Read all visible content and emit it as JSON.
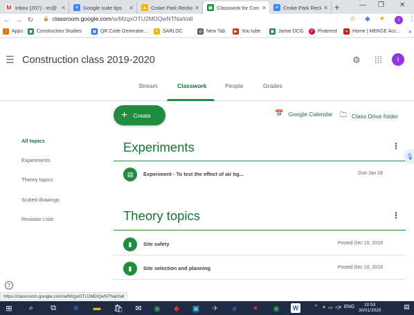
{
  "browser": {
    "tabs": [
      {
        "title": "Inbox (207) - irc@",
        "favicon": "gmail-icon",
        "color": "#d93025"
      },
      {
        "title": "Google suite tips",
        "favicon": "docs-icon",
        "color": "#4285f4"
      },
      {
        "title": "Croke Park Reckon",
        "favicon": "drive-icon",
        "color": "#f4b400"
      },
      {
        "title": "Classwork for Con",
        "favicon": "classroom-icon",
        "color": "#1e8e3e"
      },
      {
        "title": "Croke Park Reckon",
        "favicon": "docs-icon",
        "color": "#4285f4"
      }
    ],
    "new_tab": "+",
    "url_host": "classroom.google.com",
    "url_path": "/w/MzgxOTU2MDQwNTNa/t/all",
    "bookmarks": [
      {
        "label": "Apps",
        "icon": "apps-grid-icon",
        "color": "#e8710a"
      },
      {
        "label": "Construction Studies",
        "icon": "classroom-icon",
        "color": "#1e8e3e"
      },
      {
        "label": "QR Code Generator...",
        "icon": "qr-icon",
        "color": "#1a73e8"
      },
      {
        "label": "SARLOC",
        "icon": "sarloc-icon",
        "color": "#f4b400"
      },
      {
        "label": "New Tab",
        "icon": "globe-icon",
        "color": "#5f6368"
      },
      {
        "label": "You tube",
        "icon": "youtube-icon",
        "color": "#d93025"
      },
      {
        "label": "Jamie DCG",
        "icon": "classroom-icon",
        "color": "#1e8e3e"
      },
      {
        "label": "Pinterest",
        "icon": "pinterest-icon",
        "color": "#e60023"
      },
      {
        "label": "Home | MERGE Acc...",
        "icon": "merge-icon",
        "color": "#c5221f"
      }
    ],
    "profile_initial": "I"
  },
  "classroom": {
    "title": "Construction class 2019-2020",
    "avatar_initial": "I",
    "tabs": [
      "Stream",
      "Classwork",
      "People",
      "Grades"
    ],
    "active_tab": "Classwork",
    "create_label": "Create",
    "google_calendar": "Google Calendar",
    "class_drive": "Class Drive folder",
    "sidebar": [
      "All topics",
      "Experiments",
      "Theory topics",
      "Scaled drawings",
      "Revision Lists"
    ],
    "topics": [
      {
        "title": "Experiments",
        "items": [
          {
            "title": "Experiment - To test the effect of air tig...",
            "meta": "Due Jan 28",
            "icon": "assignment-icon"
          }
        ]
      },
      {
        "title": "Theory topics",
        "items": [
          {
            "title": "Site safety",
            "meta": "Posted Dec 10, 2019",
            "icon": "material-icon"
          },
          {
            "title": "Site selection and planning",
            "meta": "Posted Dec 10, 2019",
            "icon": "material-icon"
          }
        ]
      }
    ],
    "status_url": "https://classroom.google.com/w/MzgxOTU2MDQwNTNa/t/all"
  },
  "taskbar": {
    "language": "ENG",
    "time": "10:53",
    "date": "30/01/2020"
  },
  "colors": {
    "accent": "#1e8e3e",
    "accent_text": "#137333",
    "taskbar": "#1f2a44"
  }
}
